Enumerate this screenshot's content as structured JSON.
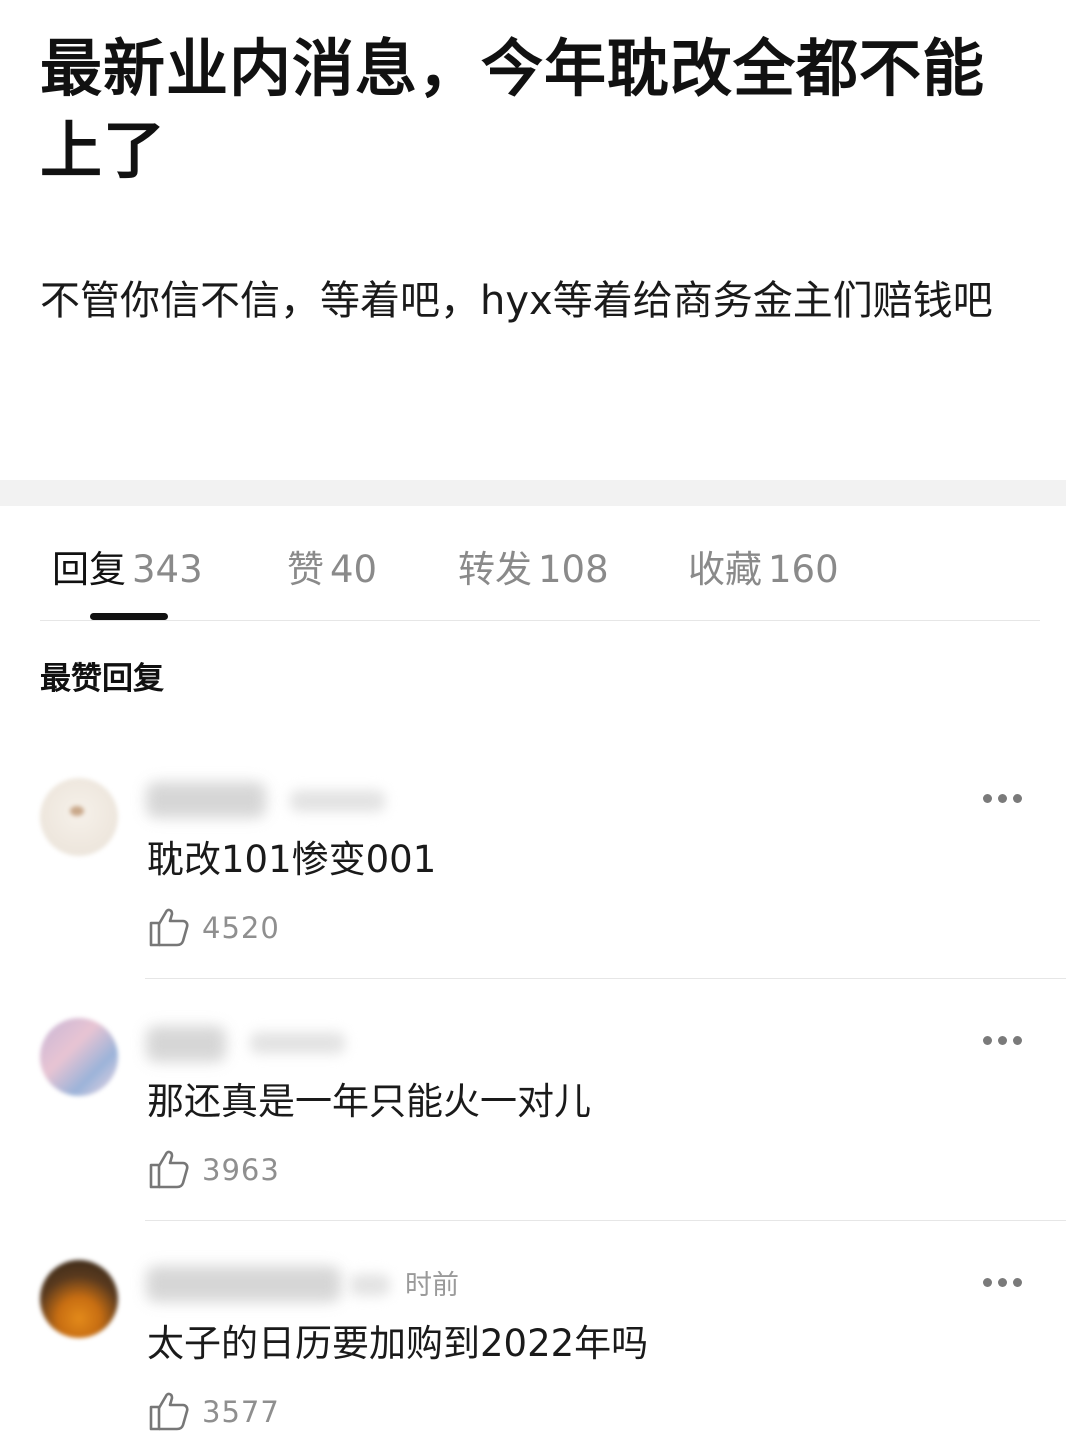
{
  "post": {
    "title": "最新业内消息，今年耽改全都不能上了",
    "body": "不管你信不信，等着吧，hyx等着给商务金主们赔钱吧"
  },
  "tabs": [
    {
      "label": "回复",
      "count": "343",
      "active": true
    },
    {
      "label": "赞",
      "count": "40",
      "active": false
    },
    {
      "label": "转发",
      "count": "108",
      "active": false
    },
    {
      "label": "收藏",
      "count": "160",
      "active": false
    }
  ],
  "section_title": "最赞回复",
  "comments": [
    {
      "text": "耽改101惨变001",
      "likes": "4520",
      "time": ""
    },
    {
      "text": "那还真是一年只能火一对儿",
      "likes": "3963",
      "time": ""
    },
    {
      "text": "太子的日历要加购到2022年吗",
      "likes": "3577",
      "time": "时前"
    }
  ],
  "icons": {
    "like": "thumbs-up-icon",
    "more": "more-dots-icon"
  },
  "colors": {
    "text_primary": "#111111",
    "text_secondary": "#8a8a8a",
    "separator": "#e6e6e6",
    "band": "#f2f2f2"
  }
}
